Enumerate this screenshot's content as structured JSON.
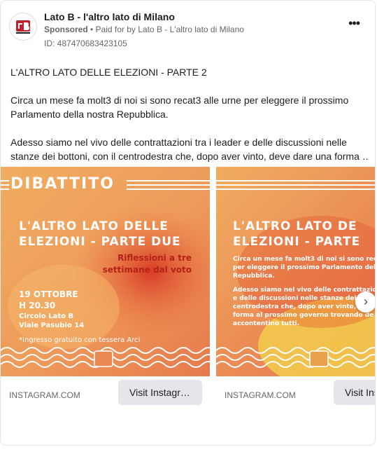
{
  "post": {
    "page_name": "Lato B - l'altro lato di Milano",
    "sponsored": "Sponsored",
    "paid_prefix": " • Paid for by ",
    "paid_by": "Lato B - L'altro lato di Milano",
    "ad_id": "ID: 487470683423105",
    "more_label": "•••",
    "text": {
      "line1": "L'ALTRO LATO DELLE ELEZIONI - PARTE 2",
      "line2": "Circa un mese fa molt3 di noi si sono recat3 alle urne per eleggere il prossimo",
      "line3": "Parlamento della nostra Repubblica.",
      "line4": "Adesso siamo nel vivo delle contrattazioni tra i leader e delle discussioni nelle",
      "line5": "stanze dei bottoni, con il centrodestra che, dopo aver vinto, deve dare una forma …"
    }
  },
  "carousel": {
    "next_icon": "›",
    "slides": [
      {
        "header": "DIBATTITO",
        "title_line1": "L'ALTRO LATO DELLE",
        "title_line2": "ELEZIONI - PARTE DUE",
        "subtitle_line1": "Riflessioni a tre",
        "subtitle_line2": "settimane dal voto",
        "date": "19 OTTOBRE",
        "time": "H 20.30",
        "venue1": "Circolo Lato B",
        "venue2": "Viale Pasubio 14",
        "note": "*Ingresso gratuito con tessera Arci",
        "domain": "INSTAGRAM.COM",
        "cta": "Visit Instagr…"
      },
      {
        "title_line1": "L'ALTRO LATO DE",
        "title_line2": "ELEZIONI - PARTE",
        "para1_l1": "Circa un mese fa molt3 di noi si sono recat3",
        "para1_l2": "per eleggere il prossimo Parlamento della",
        "para1_l3": "Repubblica.",
        "para2_l1": "Adesso siamo nel vivo delle contrattazioni tra",
        "para2_l2": "e delle discussioni nelle stanze dei b",
        "para2_l3": "centrodestra che, dopo aver vinto, d",
        "para2_l4": "forma al prossimo governo trovando de",
        "para2_l5": "accontentino tutti.",
        "domain": "INSTAGRAM.COM",
        "cta": "Visit Ins"
      }
    ]
  },
  "colors": {
    "poster_orange": "#f0a35a",
    "poster_red": "#d9442b",
    "poster_yellow": "#f2c94c",
    "cta_bg": "#e4e6eb"
  }
}
